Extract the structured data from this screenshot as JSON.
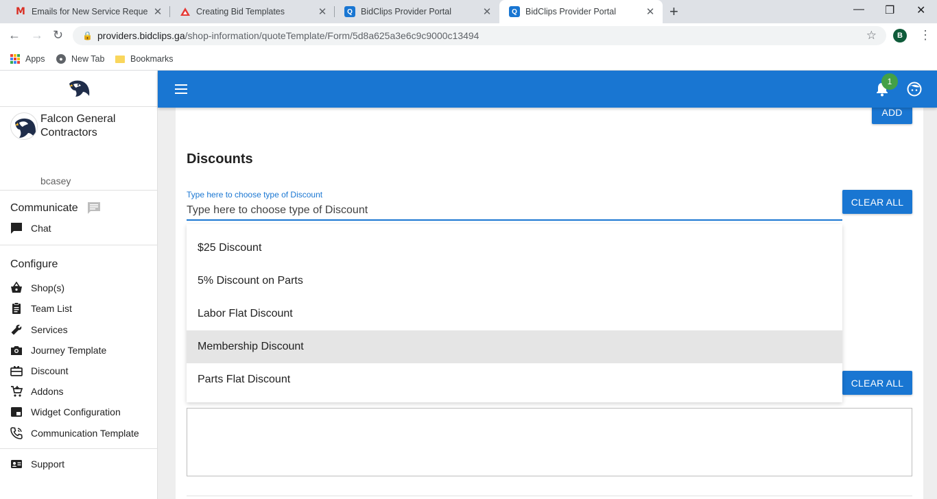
{
  "browser": {
    "tabs": [
      {
        "title": "Emails for New Service Requests",
        "favicon": "gmail-icon",
        "active": false
      },
      {
        "title": "Creating Bid Templates",
        "favicon": "triangle-logo-icon",
        "active": false
      },
      {
        "title": "BidClips Provider Portal",
        "favicon": "q-logo-icon",
        "active": false
      },
      {
        "title": "BidClips Provider Portal",
        "favicon": "q-logo-icon",
        "active": true
      }
    ],
    "close_glyph": "✕",
    "new_tab_glyph": "+",
    "url_host": "providers.bidclips.ga",
    "url_path": "/shop-information/quoteTemplate/Form/5d8a625a3e6c9c9000c13494",
    "profile_initial": "B",
    "bookmarks": [
      {
        "label": "Apps",
        "icon": "apps-grid-icon"
      },
      {
        "label": "New Tab",
        "icon": "globe-icon"
      },
      {
        "label": "Bookmarks",
        "icon": "folder-icon"
      }
    ]
  },
  "sidebar": {
    "company_name": "Falcon General Contractors",
    "username": "bcasey",
    "sections": [
      {
        "title": "Communicate",
        "items": [
          {
            "label": "Chat",
            "icon": "chat-icon"
          }
        ]
      },
      {
        "title": "Configure",
        "items": [
          {
            "label": "Shop(s)",
            "icon": "basket-icon"
          },
          {
            "label": "Team List",
            "icon": "clipboard-icon"
          },
          {
            "label": "Services",
            "icon": "wrench-icon"
          },
          {
            "label": "Journey Template",
            "icon": "camera-icon"
          },
          {
            "label": "Discount",
            "icon": "card-giftcard-icon"
          },
          {
            "label": "Addons",
            "icon": "cart-plus-icon"
          },
          {
            "label": "Widget Configuration",
            "icon": "widget-icon"
          },
          {
            "label": "Communication Template",
            "icon": "phone-icon"
          }
        ]
      }
    ],
    "support_label": "Support"
  },
  "appbar": {
    "notification_count": "1"
  },
  "main": {
    "add_label": "ADD",
    "section_title": "Discounts",
    "discount_field": {
      "label": "Type here to choose type of Discount",
      "placeholder": "Type here to choose type of Discount",
      "value": ""
    },
    "clear_all_label": "CLEAR ALL",
    "options": [
      {
        "label": "$25 Discount",
        "highlighted": false
      },
      {
        "label": "5% Discount on Parts",
        "highlighted": false
      },
      {
        "label": "Labor Flat Discount",
        "highlighted": false
      },
      {
        "label": "Membership Discount",
        "highlighted": true
      },
      {
        "label": "Parts Flat Discount",
        "highlighted": false
      }
    ]
  },
  "colors": {
    "primary": "#1976d2",
    "badge": "#43a047",
    "highlight": "#e5e5e5"
  }
}
